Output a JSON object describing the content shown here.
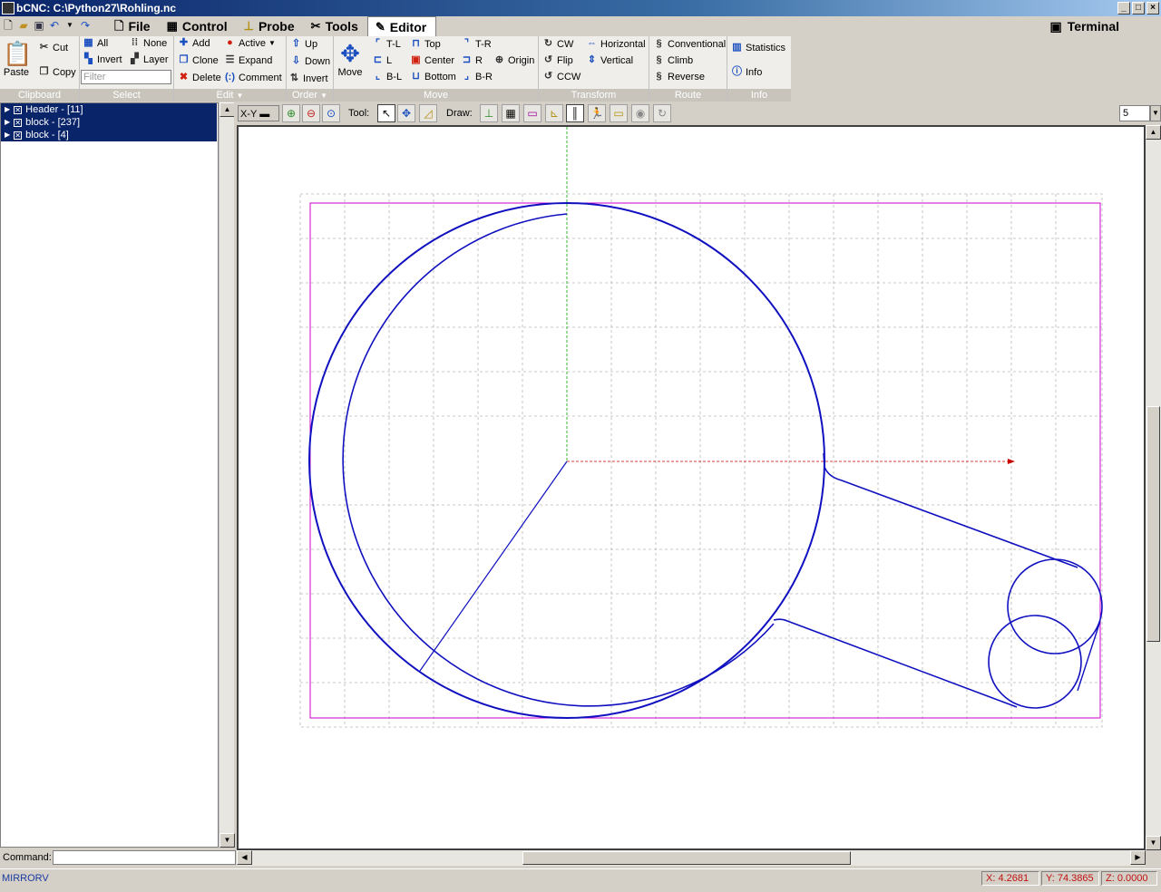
{
  "window": {
    "title": "bCNC: C:\\Python27\\Rohling.nc",
    "controls": [
      "_",
      "□",
      "×"
    ]
  },
  "menu": {
    "tabs": [
      {
        "label": "File",
        "icon": "file-icon"
      },
      {
        "label": "Control",
        "icon": "control-icon"
      },
      {
        "label": "Probe",
        "icon": "probe-icon"
      },
      {
        "label": "Tools",
        "icon": "tools-icon"
      },
      {
        "label": "Editor",
        "icon": "editor-icon",
        "active": true
      }
    ],
    "terminal": "Terminal"
  },
  "ribbon": {
    "clipboard": {
      "label": "Clipboard",
      "paste": "Paste",
      "cut": "Cut",
      "copy": "Copy"
    },
    "select": {
      "label": "Select",
      "all": "All",
      "none": "None",
      "invert": "Invert",
      "layer": "Layer",
      "filter_placeholder": "Filter"
    },
    "edit": {
      "label": "Edit",
      "add": "Add",
      "active": "Active",
      "clone": "Clone",
      "expand": "Expand",
      "delete": "Delete",
      "comment": "Comment"
    },
    "order": {
      "label": "Order",
      "up": "Up",
      "down": "Down",
      "invert": "Invert"
    },
    "move": {
      "label": "Move",
      "move": "Move",
      "tl": "T-L",
      "top": "Top",
      "tr": "T-R",
      "l": "L",
      "center": "Center",
      "r": "R",
      "bl": "B-L",
      "bottom": "Bottom",
      "br": "B-R",
      "origin": "Origin"
    },
    "transform": {
      "label": "Transform",
      "cw": "CW",
      "horizontal": "Horizontal",
      "flip": "Flip",
      "vertical": "Vertical",
      "ccw": "CCW"
    },
    "route": {
      "label": "Route",
      "conventional": "Conventional",
      "climb": "Climb",
      "reverse": "Reverse"
    },
    "info": {
      "label": "Info",
      "statistics": "Statistics",
      "info": "Info"
    }
  },
  "tree": {
    "rows": [
      {
        "label": "Header - [11]"
      },
      {
        "label": "block - [237]"
      },
      {
        "label": "block - [4]"
      }
    ]
  },
  "canvas_toolbar": {
    "view": "X-Y",
    "tool_label": "Tool:",
    "draw_label": "Draw:",
    "zoom_value": "5"
  },
  "command": {
    "label": "Command:"
  },
  "status": {
    "message": "MIRRORV",
    "x": "X: 4.2681",
    "y": "Y: 74.3865",
    "z": "Z: 0.0000"
  },
  "colors": {
    "toolpath": "#1010c0",
    "margin": "#cc00cc",
    "grid": "#b0b0b0",
    "x_axis": "#cc0000",
    "y_axis": "#00aa00",
    "selection": "#0a246a"
  }
}
